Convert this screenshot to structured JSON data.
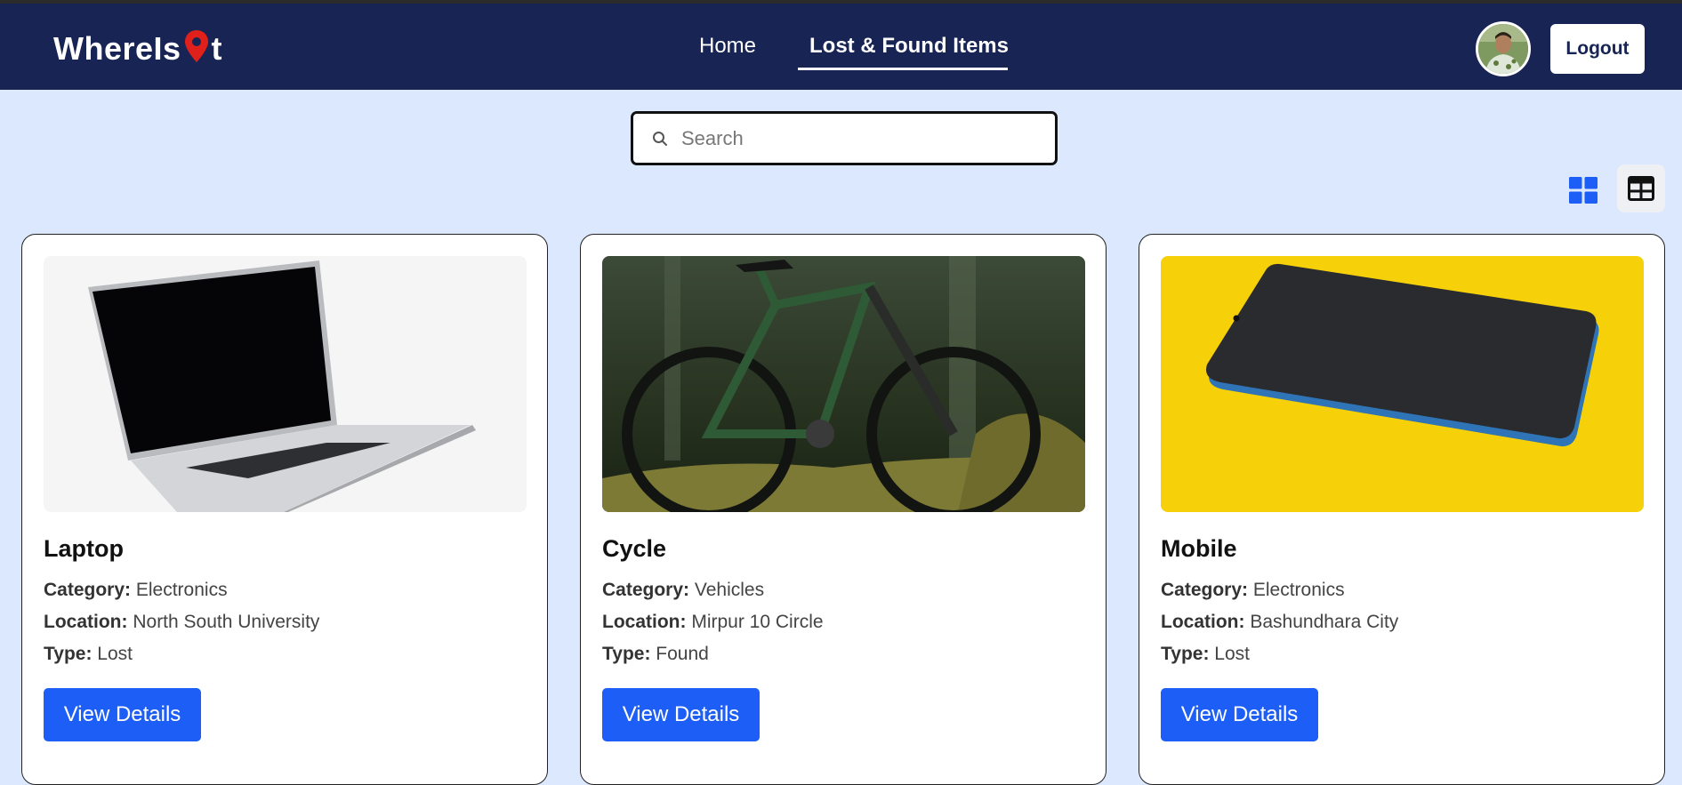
{
  "brand": {
    "prefix": "WhereIs",
    "suffix": "t"
  },
  "nav": {
    "home": "Home",
    "lost_found": "Lost & Found Items",
    "active": "lost_found"
  },
  "header": {
    "logout_label": "Logout"
  },
  "search": {
    "placeholder": "Search",
    "value": ""
  },
  "view_toggle": {
    "options": [
      "grid-view",
      "table-view"
    ],
    "active": "table-view"
  },
  "labels": {
    "category": "Category:",
    "location": "Location:",
    "type": "Type:",
    "view_details": "View Details"
  },
  "items": [
    {
      "title": "Laptop",
      "category": "Electronics",
      "location": "North South University",
      "type": "Lost",
      "image": "laptop-photo"
    },
    {
      "title": "Cycle",
      "category": "Vehicles",
      "location": "Mirpur 10 Circle",
      "type": "Found",
      "image": "bicycle-photo"
    },
    {
      "title": "Mobile",
      "category": "Electronics",
      "location": "Bashundhara City",
      "type": "Lost",
      "image": "smartphone-photo"
    }
  ],
  "colors": {
    "navbar": "#172454",
    "page_bg": "#dbe8fd",
    "accent": "#1d5ef6",
    "pin": "#e0201b"
  }
}
